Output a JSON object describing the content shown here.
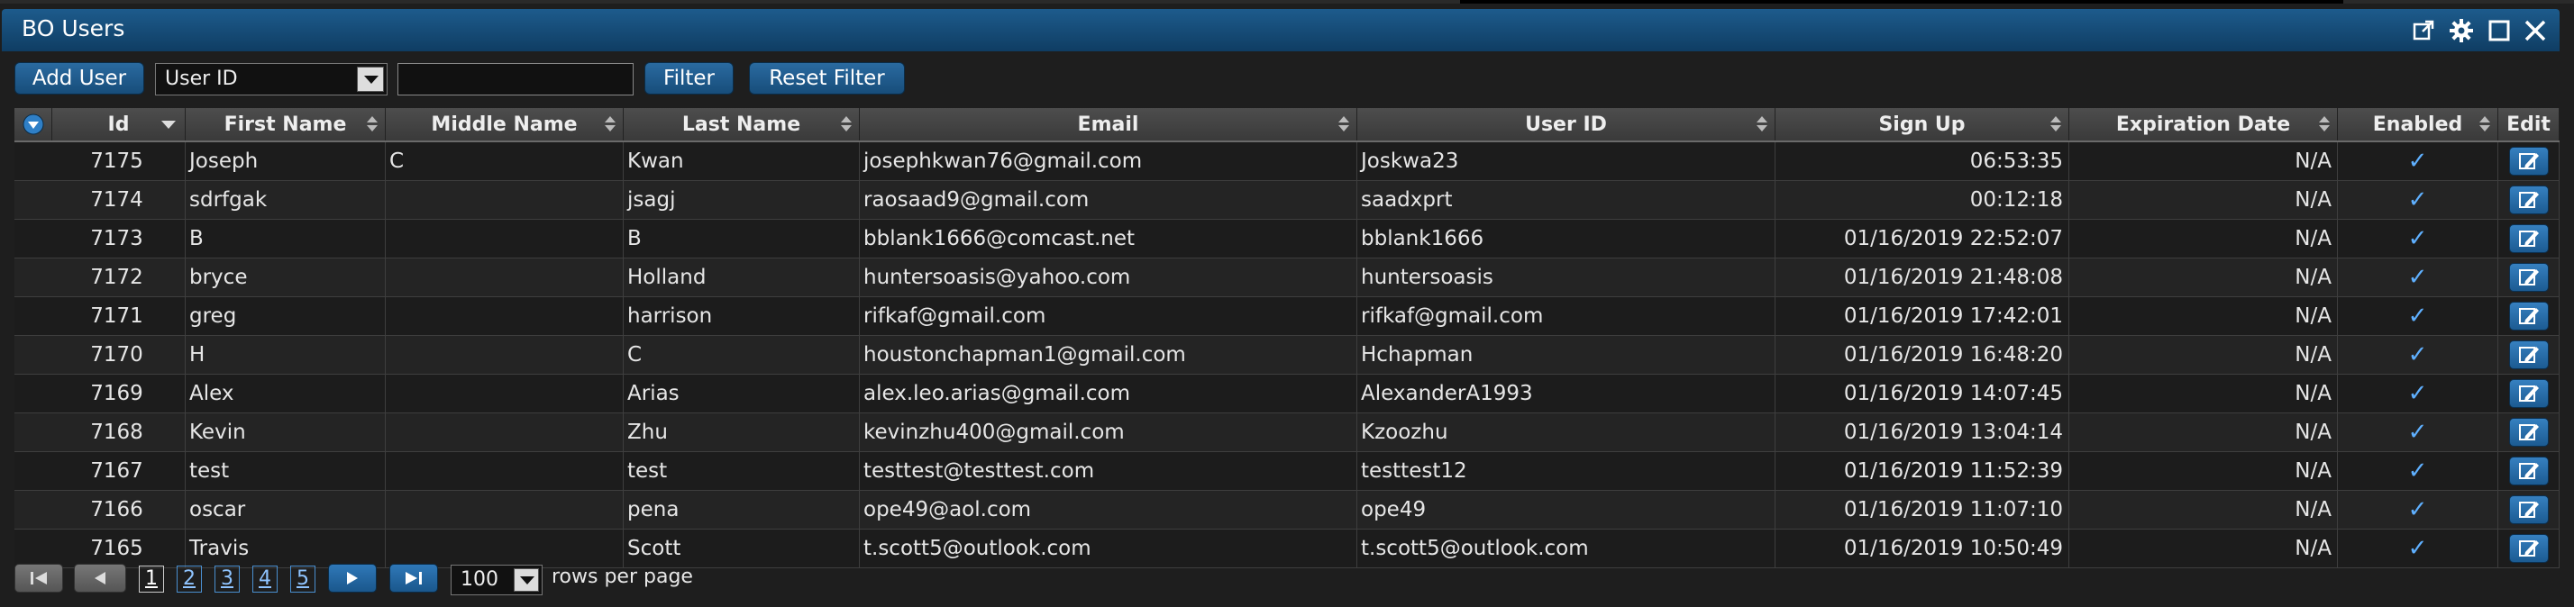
{
  "window": {
    "title": "BO Users",
    "icons": [
      "external-link-icon",
      "gear-icon",
      "maximize-icon",
      "close-icon"
    ]
  },
  "toolbar": {
    "add_user_label": "Add User",
    "filter_field_value": "User ID",
    "filter_text_value": "",
    "filter_label": "Filter",
    "reset_filter_label": "Reset Filter"
  },
  "table": {
    "columns": [
      "Id",
      "First Name",
      "Middle Name",
      "Last Name",
      "Email",
      "User ID",
      "Sign Up",
      "Expiration Date",
      "Enabled",
      "Edit"
    ],
    "rows": [
      {
        "id": "7175",
        "first": "Joseph",
        "middle": "C",
        "last": "Kwan",
        "email": "josephkwan76@gmail.com",
        "userid": "Joskwa23",
        "signup": "06:53:35",
        "expiration": "N/A",
        "enabled": "✓"
      },
      {
        "id": "7174",
        "first": "sdrfgak",
        "middle": "",
        "last": "jsagj",
        "email": "raosaad9@gmail.com",
        "userid": "saadxprt",
        "signup": "00:12:18",
        "expiration": "N/A",
        "enabled": "✓"
      },
      {
        "id": "7173",
        "first": "B",
        "middle": "",
        "last": "B",
        "email": "bblank1666@comcast.net",
        "userid": "bblank1666",
        "signup": "01/16/2019 22:52:07",
        "expiration": "N/A",
        "enabled": "✓"
      },
      {
        "id": "7172",
        "first": "bryce",
        "middle": "",
        "last": "Holland",
        "email": "huntersoasis@yahoo.com",
        "userid": "huntersoasis",
        "signup": "01/16/2019 21:48:08",
        "expiration": "N/A",
        "enabled": "✓"
      },
      {
        "id": "7171",
        "first": "greg",
        "middle": "",
        "last": "harrison",
        "email": "rifkaf@gmail.com",
        "userid": "rifkaf@gmail.com",
        "signup": "01/16/2019 17:42:01",
        "expiration": "N/A",
        "enabled": "✓"
      },
      {
        "id": "7170",
        "first": "H",
        "middle": "",
        "last": "C",
        "email": "houstonchapman1@gmail.com",
        "userid": "Hchapman",
        "signup": "01/16/2019 16:48:20",
        "expiration": "N/A",
        "enabled": "✓"
      },
      {
        "id": "7169",
        "first": "Alex",
        "middle": "",
        "last": "Arias",
        "email": "alex.leo.arias@gmail.com",
        "userid": "AlexanderA1993",
        "signup": "01/16/2019 14:07:45",
        "expiration": "N/A",
        "enabled": "✓"
      },
      {
        "id": "7168",
        "first": "Kevin",
        "middle": "",
        "last": "Zhu",
        "email": "kevinzhu400@gmail.com",
        "userid": "Kzoozhu",
        "signup": "01/16/2019 13:04:14",
        "expiration": "N/A",
        "enabled": "✓"
      },
      {
        "id": "7167",
        "first": "test",
        "middle": "",
        "last": "test",
        "email": "testtest@testtest.com",
        "userid": "testtest12",
        "signup": "01/16/2019 11:52:39",
        "expiration": "N/A",
        "enabled": "✓"
      },
      {
        "id": "7166",
        "first": "oscar",
        "middle": "",
        "last": "pena",
        "email": "ope49@aol.com",
        "userid": "ope49",
        "signup": "01/16/2019 11:07:10",
        "expiration": "N/A",
        "enabled": "✓"
      },
      {
        "id": "7165",
        "first": "Travis",
        "middle": "",
        "last": "Scott",
        "email": "t.scott5@outlook.com",
        "userid": "t.scott5@outlook.com",
        "signup": "01/16/2019 10:50:49",
        "expiration": "N/A",
        "enabled": "✓"
      }
    ]
  },
  "pagination": {
    "pages": [
      "1",
      "2",
      "3",
      "4",
      "5"
    ],
    "current_page": "1",
    "rows_per_page_value": "100",
    "rows_per_page_label": "rows per page"
  },
  "colors": {
    "title_bar": "#1d5b8c",
    "button": "#2a6aa0",
    "check": "#5fb0ff",
    "link": "#8fc4ff"
  }
}
